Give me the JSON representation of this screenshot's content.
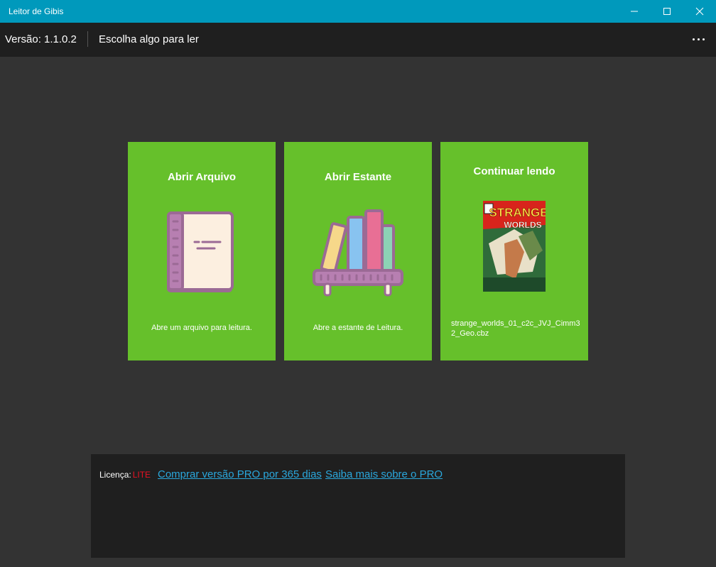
{
  "window": {
    "title": "Leitor de Gibis"
  },
  "appbar": {
    "version_label": "Versão:",
    "version_value": "1.1.0.2",
    "subtitle": "Escolha algo para ler"
  },
  "cards": {
    "open_file": {
      "title": "Abrir Arquivo",
      "description": "Abre um arquivo para leitura."
    },
    "open_shelf": {
      "title": "Abrir Estante",
      "description": "Abre a estante de Leitura."
    },
    "continue": {
      "title": "Continuar lendo",
      "filename": "strange_worlds_01_c2c_JVJ_Cimm32_Geo.cbz",
      "cover_title_top": "STRANGE",
      "cover_title_bottom": "WORLDS"
    }
  },
  "license": {
    "label": "Licença:",
    "value": "LITE",
    "buy_link": "Comprar versão PRO por 365 dias",
    "learn_link": "Saiba mais sobre o PRO"
  },
  "colors": {
    "titlebar": "#0099bc",
    "card_green": "#66c02b",
    "appbar": "#1f1f1f",
    "background": "#333333",
    "link": "#2aa7dc",
    "license_lite": "#e81123"
  }
}
